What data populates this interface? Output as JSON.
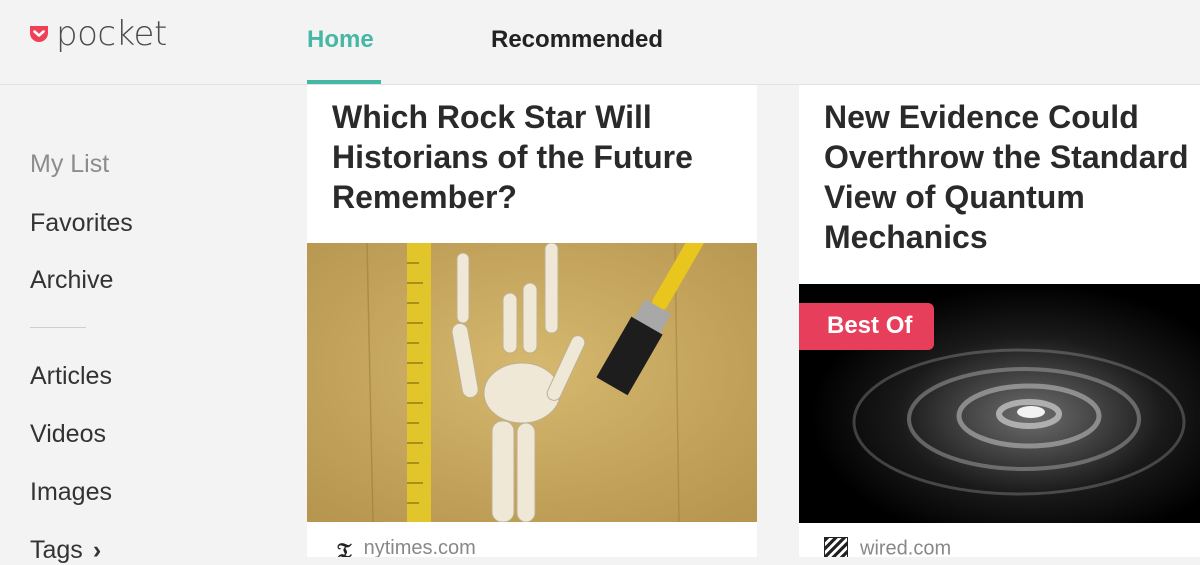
{
  "app": {
    "logo_text": "pocket"
  },
  "nav": {
    "tabs": [
      {
        "label": "Home",
        "active": true
      },
      {
        "label": "Recommended",
        "active": false
      }
    ]
  },
  "sidebar": {
    "items": [
      {
        "label": "My List",
        "active": true
      },
      {
        "label": "Favorites"
      },
      {
        "label": "Archive"
      },
      {
        "label": "Articles"
      },
      {
        "label": "Videos"
      },
      {
        "label": "Images"
      },
      {
        "label": "Tags"
      }
    ]
  },
  "cards": [
    {
      "title": "Which Rock Star Will Historians of the Future Remember?",
      "source": "nytimes.com",
      "source_icon": "nytimes-logo-icon"
    },
    {
      "title_lines": [
        "New Evidence Could",
        "Overthrow the Standard",
        "View of Quantum",
        "Mechanics"
      ],
      "badge": "Best Of",
      "source": "wired.com",
      "source_icon": "wired-logo-icon"
    }
  ],
  "colors": {
    "accent": "#45b7a4",
    "brand": "#ef4056",
    "badge": "#e63e5b"
  }
}
